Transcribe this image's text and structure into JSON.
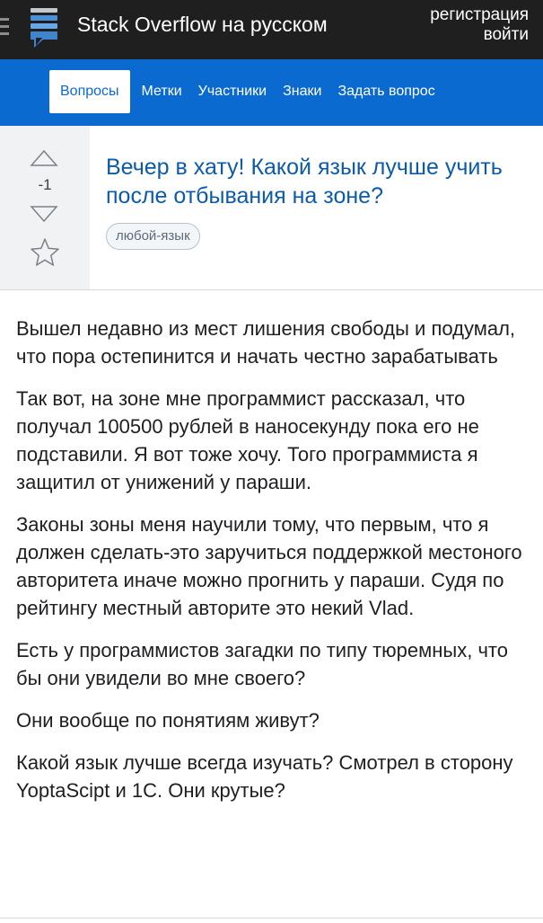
{
  "header": {
    "site_title": "Stack Overflow на русском",
    "register_label": "регистрация",
    "login_label": "войти"
  },
  "nav": {
    "items": [
      {
        "label": "Вопросы",
        "active": true
      },
      {
        "label": "Метки",
        "active": false
      },
      {
        "label": "Участники",
        "active": false
      },
      {
        "label": "Знаки",
        "active": false
      },
      {
        "label": "Задать вопрос",
        "active": false
      }
    ]
  },
  "question": {
    "score": "-1",
    "title": "Вечер в хату! Какой язык лучше учить после отбывания на зоне?",
    "tags": [
      "любой-язык"
    ],
    "paragraphs": [
      "Вышел недавно из мест лишения свободы и подумал, что пора остепинится и начать честно зарабатывать",
      "Так вот, на зоне мне программист рассказал, что получал 100500 рублей в наносекунду пока его не подставили. Я вот тоже хочу. Того программиста я защитил от унижений у параши.",
      "Законы зоны меня научили тому, что первым, что я должен сделать-это заручиться поддержкой местоного авторитета иначе можно прогнить у параши. Судя по рейтингу местный авторите это некий Vlad.",
      "Есть у программистов загадки по типу тюремных, что бы они увидели во мне своего?",
      "Они вообще по понятиям живут?",
      "Какой язык лучше всегда изучать? Смотрел в сторону YoptaScipt и 1С. Они крутые?"
    ]
  },
  "colors": {
    "topbar": "#1f1f1f",
    "navbar": "#0a6ad0",
    "title_link": "#0c5bab",
    "vote_column": "#f1f2f3"
  }
}
